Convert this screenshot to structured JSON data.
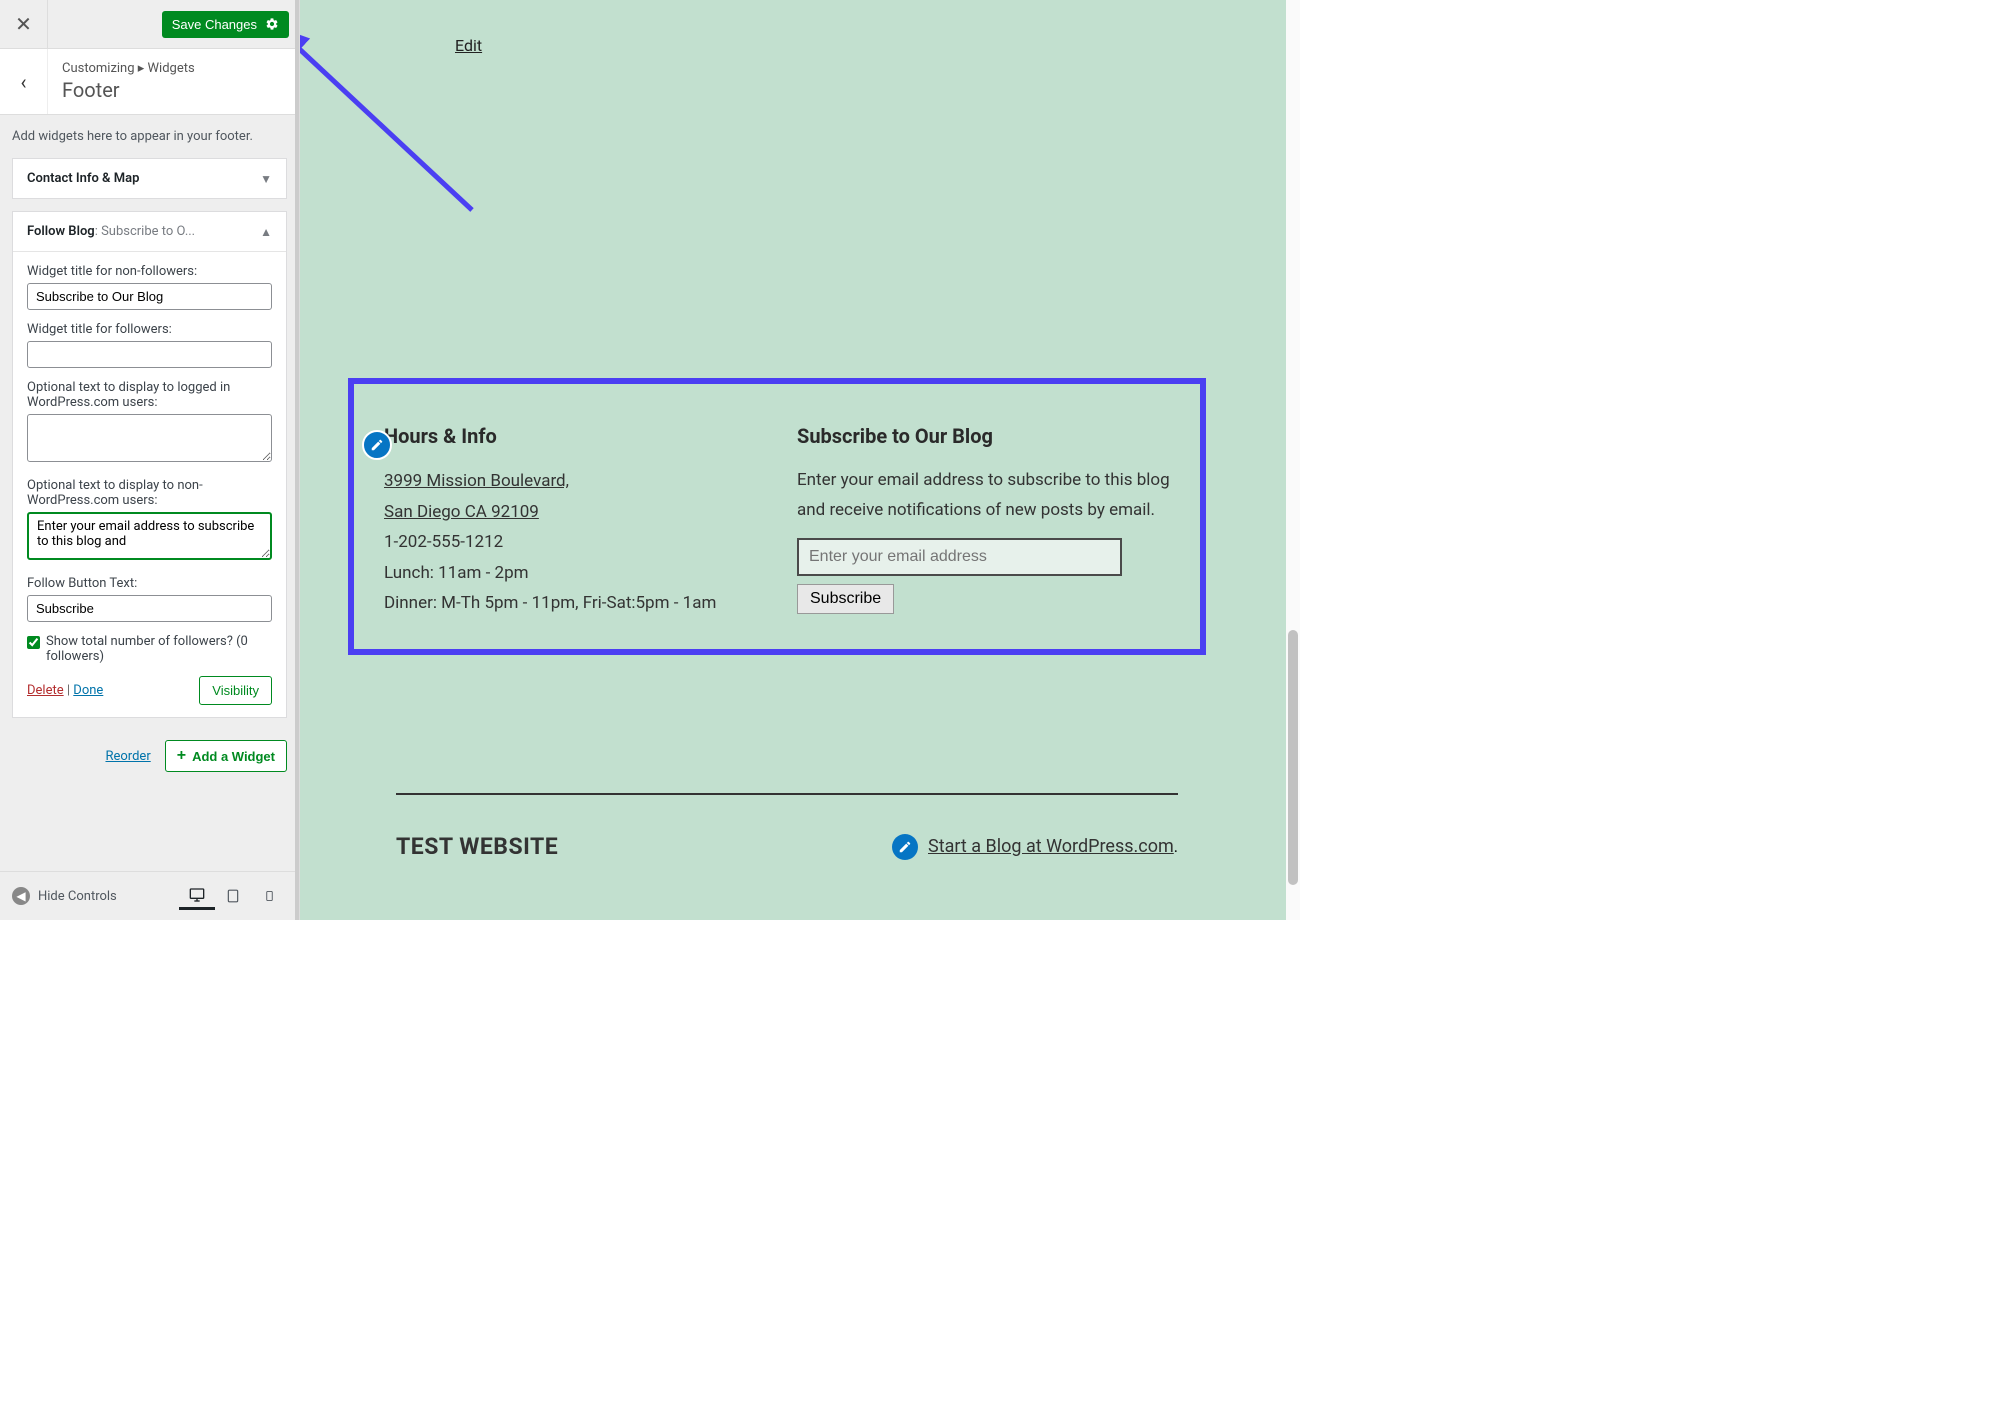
{
  "header": {
    "save_label": "Save Changes"
  },
  "breadcrumb": {
    "path_prefix": "Customizing",
    "path_section": "Widgets",
    "title": "Footer"
  },
  "help_text": "Add widgets here to appear in your footer.",
  "widgets": {
    "contact": {
      "title": "Contact Info & Map"
    },
    "follow": {
      "title": "Follow Blog",
      "subtitle": ": Subscribe to O...",
      "fields": {
        "nonfollower_title_label": "Widget title for non-followers:",
        "nonfollower_title_value": "Subscribe to Our Blog",
        "follower_title_label": "Widget title for followers:",
        "follower_title_value": "",
        "logged_in_label": "Optional text to display to logged in WordPress.com users:",
        "logged_in_value": "",
        "non_wp_label": "Optional text to display to non-WordPress.com users:",
        "non_wp_value": "Enter your email address to subscribe to this blog and",
        "button_text_label": "Follow Button Text:",
        "button_text_value": "Subscribe",
        "show_followers_label": "Show total number of followers? (0 followers)"
      },
      "actions": {
        "delete": "Delete",
        "done": "Done",
        "visibility": "Visibility"
      }
    }
  },
  "sidebar_footer": {
    "reorder": "Reorder",
    "add_widget": "Add a Widget"
  },
  "controls": {
    "hide": "Hide Controls"
  },
  "preview": {
    "edit": "Edit",
    "hours": {
      "heading": "Hours & Info",
      "address1": "3999 Mission Boulevard,",
      "address2": "San Diego CA 92109",
      "phone": "1-202-555-1212",
      "lunch": "Lunch: 11am - 2pm",
      "dinner": "Dinner: M-Th 5pm - 11pm, Fri-Sat:5pm - 1am"
    },
    "subscribe": {
      "heading": "Subscribe to Our Blog",
      "desc": "Enter your email address to subscribe to this blog and receive notifications of new posts by email.",
      "placeholder": "Enter your email address",
      "button": "Subscribe"
    },
    "site_title": "TEST WEBSITE",
    "wp_link": "Start a Blog at WordPress.com",
    "wp_link_suffix": "."
  }
}
